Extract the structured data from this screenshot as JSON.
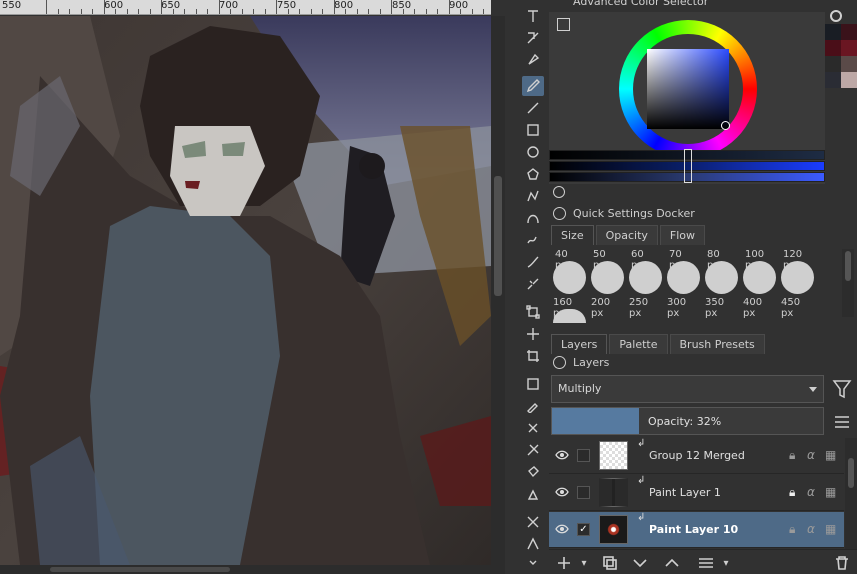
{
  "ruler": {
    "labels": [
      "550",
      "600",
      "650",
      "700",
      "750",
      "800",
      "850",
      "900"
    ]
  },
  "toolbox": {
    "tools": [
      "text-tool",
      "calligraphy-tool",
      "vector-edit-tool",
      "freehand-brush-tool",
      "line-tool",
      "rectangle-tool",
      "ellipse-tool",
      "polygon-tool",
      "polyline-tool",
      "bezier-tool",
      "freehand-path-tool",
      "dynamic-brush-tool",
      "multibrush-tool",
      "transform-tool",
      "move-tool",
      "crop-tool",
      "gradient-tool",
      "color-picker-tool",
      "smart-patch-tool",
      "assistant-tool",
      "fill-tool",
      "fill-select-tool",
      "measure-tool",
      "reference-tool"
    ],
    "active_tool": "freehand-brush-tool"
  },
  "color_selector": {
    "title": "Advanced Color Selector",
    "current_color": "#1d2b45",
    "swatch_colors": [
      "#191d24",
      "#3a121a",
      "#4a0e18",
      "#6a1622",
      "#2a2a2a",
      "#5a4a48",
      "#2a2c34",
      "#bda8a6"
    ]
  },
  "quick_settings": {
    "title": "Quick Settings Docker",
    "tabs": [
      "Size",
      "Opacity",
      "Flow"
    ],
    "active_tab": "Size",
    "row1_labels": [
      "40 px",
      "50 px",
      "60 px",
      "70 px",
      "80 px",
      "100 px",
      "120 px"
    ],
    "row2_labels": [
      "160 px",
      "200 px",
      "250 px",
      "300 px",
      "350 px",
      "400 px",
      "450 px"
    ]
  },
  "layers_docker": {
    "tabs": [
      "Layers",
      "Palette",
      "Brush Presets"
    ],
    "active_tab": "Layers",
    "title": "Layers",
    "blend_mode": "Multiply",
    "opacity_label": "Opacity:  32%",
    "opacity_value": 32,
    "layers": [
      {
        "name": "Group 12 Merged",
        "visible": true,
        "checked": false,
        "selected": false,
        "locked": false
      },
      {
        "name": "Paint Layer 1",
        "visible": true,
        "checked": false,
        "selected": false,
        "locked": true
      },
      {
        "name": "Paint Layer 10",
        "visible": true,
        "checked": true,
        "selected": true,
        "locked": false
      }
    ]
  },
  "colors": {
    "accent": "#4e6a87",
    "opacity_fill": "#567aa0",
    "panel_bg": "#313131"
  }
}
